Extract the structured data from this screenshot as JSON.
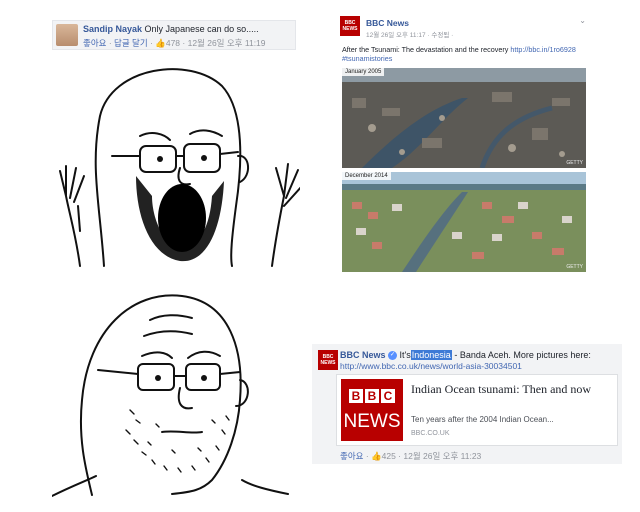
{
  "top_comment": {
    "author": "Sandip Nayak",
    "message": "Only Japanese can do so.....",
    "like_label": "좋아요",
    "reply_label": "답글 달기",
    "like_count": "478",
    "timestamp": "12월 26일 오후 11:19"
  },
  "bbc_post": {
    "page_name": "BBC News",
    "logo_line1": "BBC",
    "logo_line2": "NEWS",
    "time": "12월 26일 오후 11:17 · 수정됨 ·",
    "text": "After the Tsunami: The devastation and the recovery",
    "link": "http://bbc.in/1ro6928",
    "hashtag": "#tsunamistories",
    "photo1_label": "January 2005",
    "photo2_label": "December 2014",
    "photo1_credit": "GETTY",
    "photo2_credit": "GETTY"
  },
  "bbc_share": {
    "page_name": "BBC News",
    "lead": "It's",
    "highlight": "Indonesia",
    "rest": "- Banda Aceh. More pictures here:",
    "url": "http://www.bbc.co.uk/news/world-asia-30034501",
    "card": {
      "logo_letters": [
        "B",
        "B",
        "C"
      ],
      "logo_word": "NEWS",
      "title": "Indian Ocean tsunami: Then and now",
      "description": "Ten years after the 2004 Indian Ocean...",
      "domain": "BBC.CO.UK"
    },
    "like_label": "좋아요",
    "like_count": "425",
    "timestamp": "12월 26일 오후 11:23"
  },
  "colors": {
    "facebook_link": "#365899",
    "bbc_red": "#b80000",
    "highlight": "#3d7ad6"
  }
}
